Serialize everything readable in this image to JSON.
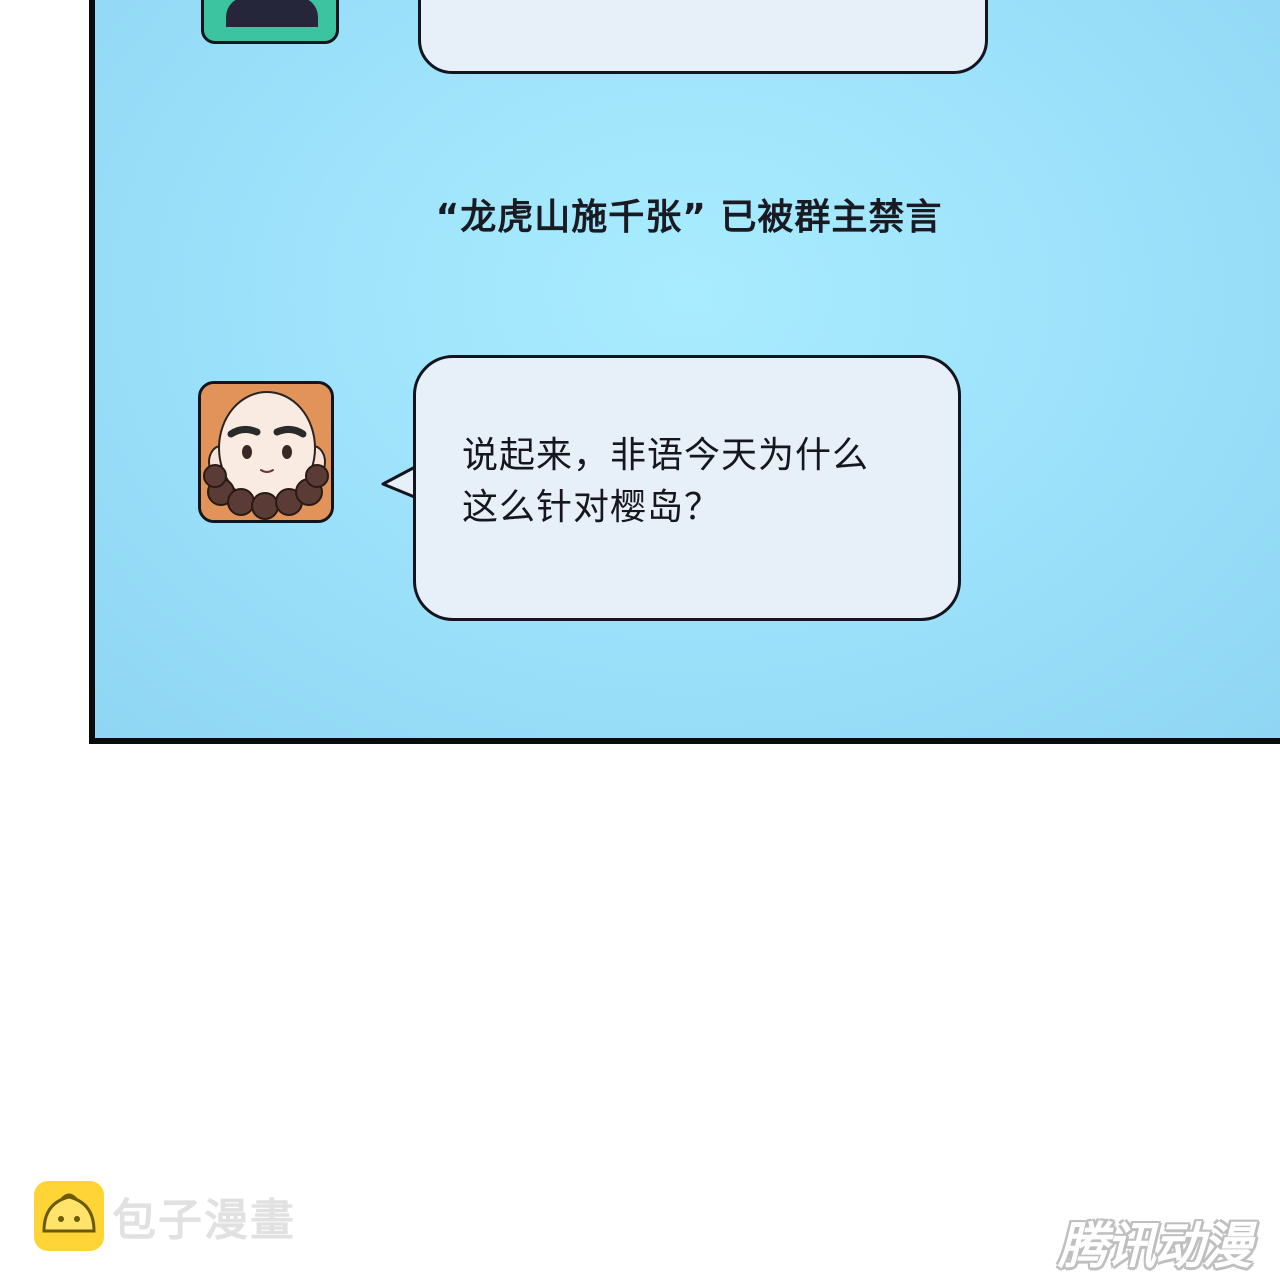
{
  "colors": {
    "panel_background": "#9ee3fb",
    "panel_border": "#0b0b0b",
    "bubble_fill": "#e7eff8",
    "text": "#16161e",
    "monk_avatar_bg": "#e1935a",
    "top_avatar_bg": "#3cc4a0",
    "watermark_logo": "#ffd436"
  },
  "chat": {
    "system_notice": "“龙虎山施千张” 已被群主禁言",
    "messages": [
      {
        "avatar": "monk-avatar",
        "text": "说起来，非语今天为什么这么针对樱岛？"
      }
    ]
  },
  "watermarks": {
    "left_label": "包子漫畫",
    "right_label": "腾讯动漫"
  }
}
